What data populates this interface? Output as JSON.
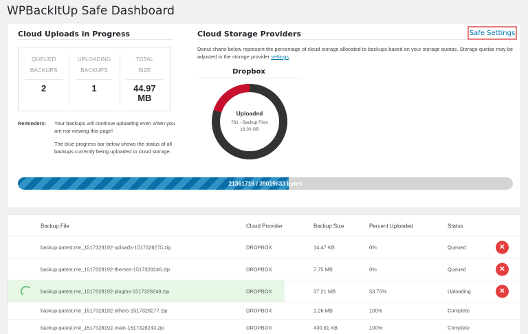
{
  "page": {
    "title": "WPBackItUp Safe Dashboard"
  },
  "uploads": {
    "title": "Cloud Uploads in Progress",
    "stats": [
      {
        "label_line1": "QUEUED",
        "label_line2": "BACKUPS",
        "value": "2"
      },
      {
        "label_line1": "UPLOADING",
        "label_line2": "BACKUPS",
        "value": "1"
      },
      {
        "label_line1": "TOTAL",
        "label_line2": "SIZE",
        "value": "44.97 MB"
      }
    ],
    "reminders_label": "Reminders:",
    "reminder_1": "Your backups will continue uploading even when you are not viewing this page!",
    "reminder_2": "The blue progress bar below shows the status of all backups currently being uploaded to cloud storage."
  },
  "providers": {
    "title": "Cloud Storage Providers",
    "safe_settings_label": "Safe Settings",
    "description": "Donut charts below represent the percentage of cloud storage allocated to backups based on your storage quotas. Storage quotas may be adjusted in the storage provider",
    "settings_link": "settings",
    "description_end": ".",
    "donut": {
      "title": "Dropbox",
      "label": "Uploaded",
      "files": "761 - Backup Files",
      "size": "16.30 GB",
      "used_fraction": 0.2,
      "used_color": "#c8102e",
      "ring_color": "#333333"
    }
  },
  "progress": {
    "text": "21361716 / 39019633 bytes",
    "fraction": 0.5475,
    "color": "#0a6ea8"
  },
  "table": {
    "headers": {
      "file": "Backup File",
      "provider": "Cloud Provider",
      "size": "Backup Size",
      "pct": "Percent Uploaded",
      "status": "Status"
    },
    "rows": [
      {
        "file": "backup.qatest.me_1517328192-uploads-1517328275.zip",
        "provider": "DROPBOX",
        "size": "14.47 KB",
        "pct": "0%",
        "status": "Queued"
      },
      {
        "file": "backup.qatest.me_1517328192-themes-1517328246.zip",
        "provider": "DROPBOX",
        "size": "7.75 MB",
        "pct": "0%",
        "status": "Queued"
      },
      {
        "file": "backup.qatest.me_1517328192-plugins-1517328249.zip",
        "provider": "DROPBOX",
        "size": "37.21 MB",
        "pct": "53.75%",
        "status": "Uploading"
      },
      {
        "file": "backup.qatest.me_1517328192-others-1517328277.zip",
        "provider": "DROPBOX",
        "size": "1.26 MB",
        "pct": "100%",
        "status": "Complete"
      },
      {
        "file": "backup.qatest.me_1517328192-main-1517328243.zip",
        "provider": "DROPBOX",
        "size": "430.81 KB",
        "pct": "100%",
        "status": "Complete"
      }
    ],
    "delete_icon": "close-icon",
    "loading_icon": "spinner-icon"
  }
}
